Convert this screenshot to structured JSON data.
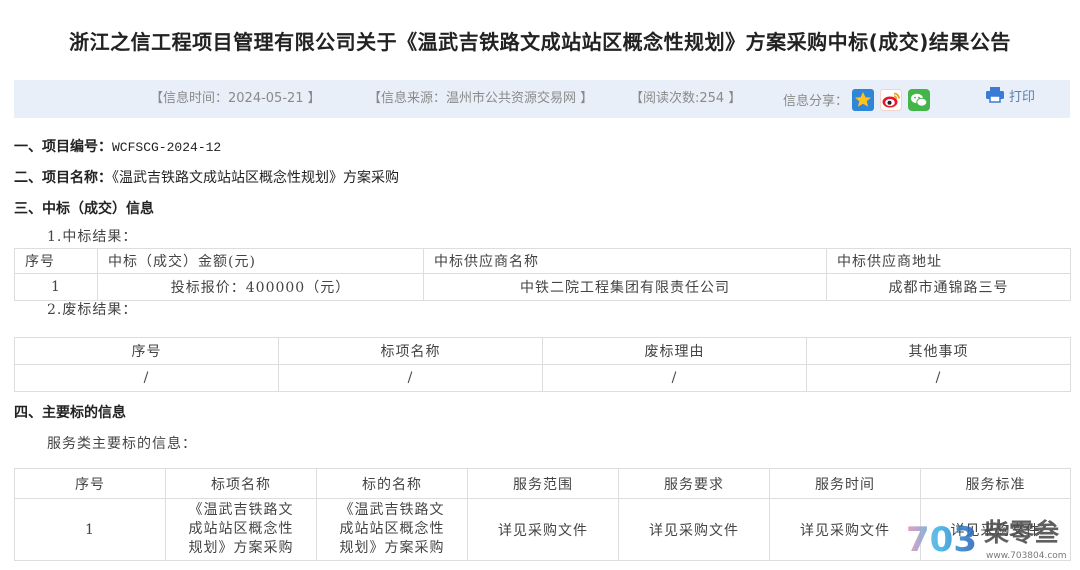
{
  "title": "浙江之信工程项目管理有限公司关于《温武吉铁路文成站站区概念性规划》方案采购中标(成交)结果公告",
  "info_bar": {
    "time": "【信息时间：2024-05-21 】",
    "source": "【信息来源：温州市公共资源交易网 】",
    "reads": "【阅读次数:254 】",
    "share_label": "信息分享：",
    "share_icons": [
      "qzone-icon",
      "weibo-icon",
      "wechat-icon"
    ],
    "print_icon": "printer-icon",
    "print_label": "打印"
  },
  "project": {
    "number_label": "一、项目编号：",
    "number_value": "WCFSCG-2024-12",
    "name_label": "二、项目名称：",
    "name_value": "《温武吉铁路文成站站区概念性规划》方案采购"
  },
  "award": {
    "heading": "三、中标（成交）信息",
    "result_label": "1.中标结果：",
    "result_table": {
      "headers": [
        "序号",
        "中标（成交）金额(元)",
        "中标供应商名称",
        "中标供应商地址"
      ],
      "rows": [
        [
          "1",
          "投标报价：400000（元）",
          "中铁二院工程集团有限责任公司",
          "成都市通锦路三号"
        ]
      ]
    },
    "failed_label": "2.废标结果：",
    "failed_table": {
      "headers": [
        "序号",
        "标项名称",
        "废标理由",
        "其他事项"
      ],
      "rows": [
        [
          "/",
          "/",
          "/",
          "/"
        ]
      ]
    }
  },
  "subject": {
    "heading": "四、主要标的信息",
    "service_label": "服务类主要标的信息：",
    "service_table": {
      "headers": [
        "序号",
        "标项名称",
        "标的名称",
        "服务范围",
        "服务要求",
        "服务时间",
        "服务标准"
      ],
      "rows": [
        [
          "1",
          "《温武吉铁路文成站站区概念性规划》方案采购",
          "《温武吉铁路文成站站区概念性规划》方案采购",
          "详见采购文件",
          "详见采购文件",
          "详见采购文件",
          "详见采购文件"
        ]
      ]
    }
  },
  "watermark": {
    "logo_mark": "703",
    "brand": "柴零叁",
    "url": "www.703804.com"
  },
  "colors": {
    "info_bar_bg": "#e8eff8",
    "info_text": "#8a8a8a",
    "table_border": "#dddddd",
    "print_blue": "#3a7bd5",
    "qzone_blue": "#2f86d8",
    "weibo_red": "#e6162d",
    "wechat_green": "#44b549"
  }
}
